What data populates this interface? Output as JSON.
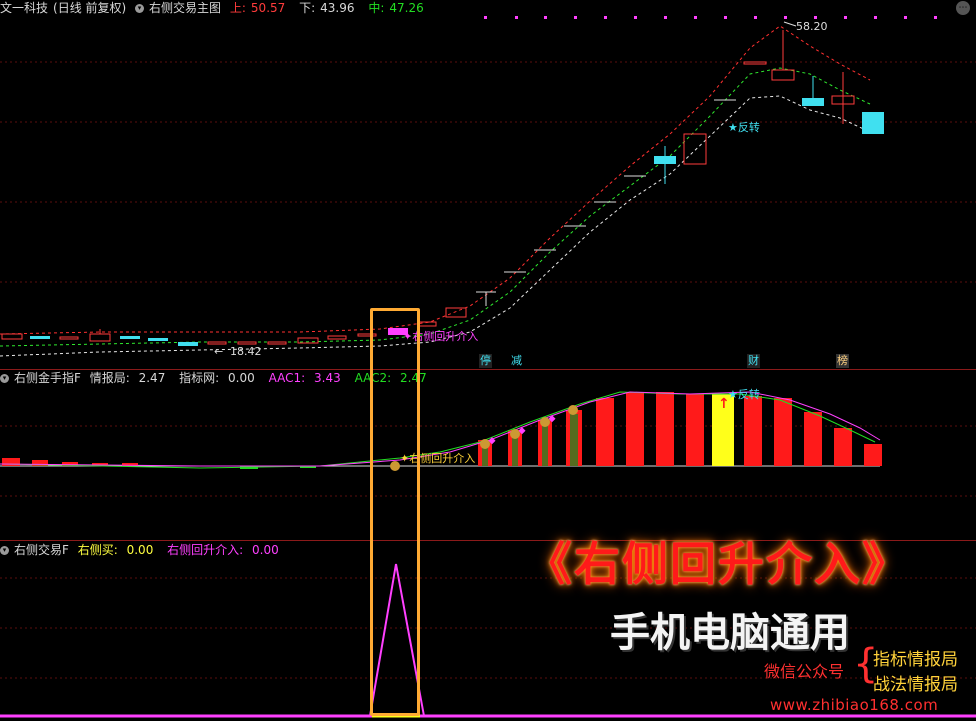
{
  "main_header": {
    "stock": "文一科技",
    "period": "(日线 前复权)",
    "indicator": "右侧交易主图",
    "upper_label": "上:",
    "upper_value": "50.57",
    "lower_label": "下:",
    "lower_value": "43.96",
    "mid_label": "中:",
    "mid_value": "47.26"
  },
  "main_chart": {
    "high_label": "58.20",
    "low_label": "18.42",
    "signal_label": "右侧回升介入",
    "reversal_label": "反转"
  },
  "tags": {
    "stop": "停",
    "reduce": "减",
    "wealth": "财",
    "top": "榜"
  },
  "sub1_header": {
    "name": "右侧金手指F",
    "k1": "情报局:",
    "v1": "2.47",
    "k2": "指标网:",
    "v2": "0.00",
    "k3": "AAC1:",
    "v3": "3.43",
    "k4": "AAC2:",
    "v4": "2.47"
  },
  "sub1_chart": {
    "signal_label": "右侧回升介入",
    "reversal_label": "反转"
  },
  "sub2_header": {
    "name": "右侧交易F",
    "k1": "右侧买:",
    "v1": "0.00",
    "k2": "右侧回升介入:",
    "v2": "0.00"
  },
  "promo": {
    "title": "《右侧回升介入》",
    "subtitle": "手机电脑通用",
    "wechat_label": "微信公众号",
    "brace": "{",
    "account1": "指标情报局",
    "account2": "战法情报局",
    "site": "www.zhibiao168.com"
  },
  "colors": {
    "up": "#ff3b3b",
    "down": "#40e0f0",
    "signal": "#ff40ff",
    "highlight_box": "#ffaa33"
  }
}
